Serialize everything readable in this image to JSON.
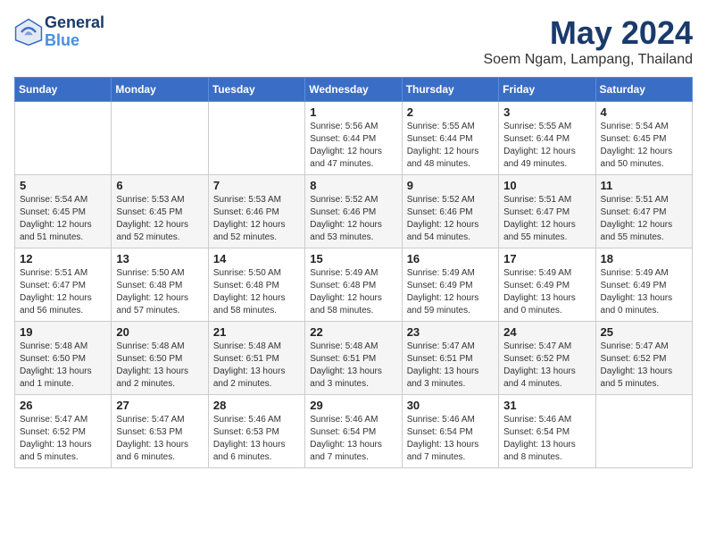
{
  "header": {
    "logo_line1": "General",
    "logo_line2": "Blue",
    "month": "May 2024",
    "location": "Soem Ngam, Lampang, Thailand"
  },
  "weekdays": [
    "Sunday",
    "Monday",
    "Tuesday",
    "Wednesday",
    "Thursday",
    "Friday",
    "Saturday"
  ],
  "weeks": [
    [
      {
        "day": "",
        "info": ""
      },
      {
        "day": "",
        "info": ""
      },
      {
        "day": "",
        "info": ""
      },
      {
        "day": "1",
        "info": "Sunrise: 5:56 AM\nSunset: 6:44 PM\nDaylight: 12 hours\nand 47 minutes."
      },
      {
        "day": "2",
        "info": "Sunrise: 5:55 AM\nSunset: 6:44 PM\nDaylight: 12 hours\nand 48 minutes."
      },
      {
        "day": "3",
        "info": "Sunrise: 5:55 AM\nSunset: 6:44 PM\nDaylight: 12 hours\nand 49 minutes."
      },
      {
        "day": "4",
        "info": "Sunrise: 5:54 AM\nSunset: 6:45 PM\nDaylight: 12 hours\nand 50 minutes."
      }
    ],
    [
      {
        "day": "5",
        "info": "Sunrise: 5:54 AM\nSunset: 6:45 PM\nDaylight: 12 hours\nand 51 minutes."
      },
      {
        "day": "6",
        "info": "Sunrise: 5:53 AM\nSunset: 6:45 PM\nDaylight: 12 hours\nand 52 minutes."
      },
      {
        "day": "7",
        "info": "Sunrise: 5:53 AM\nSunset: 6:46 PM\nDaylight: 12 hours\nand 52 minutes."
      },
      {
        "day": "8",
        "info": "Sunrise: 5:52 AM\nSunset: 6:46 PM\nDaylight: 12 hours\nand 53 minutes."
      },
      {
        "day": "9",
        "info": "Sunrise: 5:52 AM\nSunset: 6:46 PM\nDaylight: 12 hours\nand 54 minutes."
      },
      {
        "day": "10",
        "info": "Sunrise: 5:51 AM\nSunset: 6:47 PM\nDaylight: 12 hours\nand 55 minutes."
      },
      {
        "day": "11",
        "info": "Sunrise: 5:51 AM\nSunset: 6:47 PM\nDaylight: 12 hours\nand 55 minutes."
      }
    ],
    [
      {
        "day": "12",
        "info": "Sunrise: 5:51 AM\nSunset: 6:47 PM\nDaylight: 12 hours\nand 56 minutes."
      },
      {
        "day": "13",
        "info": "Sunrise: 5:50 AM\nSunset: 6:48 PM\nDaylight: 12 hours\nand 57 minutes."
      },
      {
        "day": "14",
        "info": "Sunrise: 5:50 AM\nSunset: 6:48 PM\nDaylight: 12 hours\nand 58 minutes."
      },
      {
        "day": "15",
        "info": "Sunrise: 5:49 AM\nSunset: 6:48 PM\nDaylight: 12 hours\nand 58 minutes."
      },
      {
        "day": "16",
        "info": "Sunrise: 5:49 AM\nSunset: 6:49 PM\nDaylight: 12 hours\nand 59 minutes."
      },
      {
        "day": "17",
        "info": "Sunrise: 5:49 AM\nSunset: 6:49 PM\nDaylight: 13 hours\nand 0 minutes."
      },
      {
        "day": "18",
        "info": "Sunrise: 5:49 AM\nSunset: 6:49 PM\nDaylight: 13 hours\nand 0 minutes."
      }
    ],
    [
      {
        "day": "19",
        "info": "Sunrise: 5:48 AM\nSunset: 6:50 PM\nDaylight: 13 hours\nand 1 minute."
      },
      {
        "day": "20",
        "info": "Sunrise: 5:48 AM\nSunset: 6:50 PM\nDaylight: 13 hours\nand 2 minutes."
      },
      {
        "day": "21",
        "info": "Sunrise: 5:48 AM\nSunset: 6:51 PM\nDaylight: 13 hours\nand 2 minutes."
      },
      {
        "day": "22",
        "info": "Sunrise: 5:48 AM\nSunset: 6:51 PM\nDaylight: 13 hours\nand 3 minutes."
      },
      {
        "day": "23",
        "info": "Sunrise: 5:47 AM\nSunset: 6:51 PM\nDaylight: 13 hours\nand 3 minutes."
      },
      {
        "day": "24",
        "info": "Sunrise: 5:47 AM\nSunset: 6:52 PM\nDaylight: 13 hours\nand 4 minutes."
      },
      {
        "day": "25",
        "info": "Sunrise: 5:47 AM\nSunset: 6:52 PM\nDaylight: 13 hours\nand 5 minutes."
      }
    ],
    [
      {
        "day": "26",
        "info": "Sunrise: 5:47 AM\nSunset: 6:52 PM\nDaylight: 13 hours\nand 5 minutes."
      },
      {
        "day": "27",
        "info": "Sunrise: 5:47 AM\nSunset: 6:53 PM\nDaylight: 13 hours\nand 6 minutes."
      },
      {
        "day": "28",
        "info": "Sunrise: 5:46 AM\nSunset: 6:53 PM\nDaylight: 13 hours\nand 6 minutes."
      },
      {
        "day": "29",
        "info": "Sunrise: 5:46 AM\nSunset: 6:54 PM\nDaylight: 13 hours\nand 7 minutes."
      },
      {
        "day": "30",
        "info": "Sunrise: 5:46 AM\nSunset: 6:54 PM\nDaylight: 13 hours\nand 7 minutes."
      },
      {
        "day": "31",
        "info": "Sunrise: 5:46 AM\nSunset: 6:54 PM\nDaylight: 13 hours\nand 8 minutes."
      },
      {
        "day": "",
        "info": ""
      }
    ]
  ]
}
